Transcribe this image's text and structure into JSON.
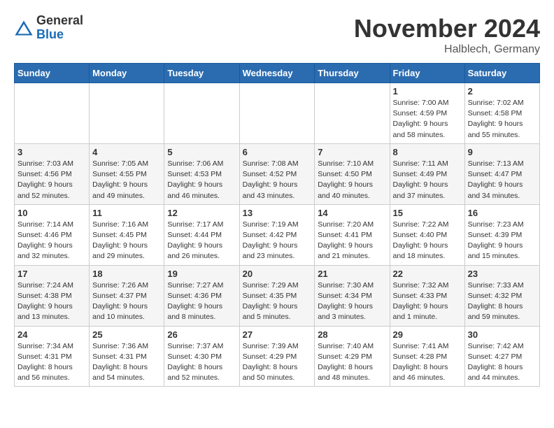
{
  "logo": {
    "general": "General",
    "blue": "Blue"
  },
  "title": "November 2024",
  "subtitle": "Halblech, Germany",
  "days_of_week": [
    "Sunday",
    "Monday",
    "Tuesday",
    "Wednesday",
    "Thursday",
    "Friday",
    "Saturday"
  ],
  "weeks": [
    [
      {
        "day": "",
        "info": ""
      },
      {
        "day": "",
        "info": ""
      },
      {
        "day": "",
        "info": ""
      },
      {
        "day": "",
        "info": ""
      },
      {
        "day": "",
        "info": ""
      },
      {
        "day": "1",
        "info": "Sunrise: 7:00 AM\nSunset: 4:59 PM\nDaylight: 9 hours and 58 minutes."
      },
      {
        "day": "2",
        "info": "Sunrise: 7:02 AM\nSunset: 4:58 PM\nDaylight: 9 hours and 55 minutes."
      }
    ],
    [
      {
        "day": "3",
        "info": "Sunrise: 7:03 AM\nSunset: 4:56 PM\nDaylight: 9 hours and 52 minutes."
      },
      {
        "day": "4",
        "info": "Sunrise: 7:05 AM\nSunset: 4:55 PM\nDaylight: 9 hours and 49 minutes."
      },
      {
        "day": "5",
        "info": "Sunrise: 7:06 AM\nSunset: 4:53 PM\nDaylight: 9 hours and 46 minutes."
      },
      {
        "day": "6",
        "info": "Sunrise: 7:08 AM\nSunset: 4:52 PM\nDaylight: 9 hours and 43 minutes."
      },
      {
        "day": "7",
        "info": "Sunrise: 7:10 AM\nSunset: 4:50 PM\nDaylight: 9 hours and 40 minutes."
      },
      {
        "day": "8",
        "info": "Sunrise: 7:11 AM\nSunset: 4:49 PM\nDaylight: 9 hours and 37 minutes."
      },
      {
        "day": "9",
        "info": "Sunrise: 7:13 AM\nSunset: 4:47 PM\nDaylight: 9 hours and 34 minutes."
      }
    ],
    [
      {
        "day": "10",
        "info": "Sunrise: 7:14 AM\nSunset: 4:46 PM\nDaylight: 9 hours and 32 minutes."
      },
      {
        "day": "11",
        "info": "Sunrise: 7:16 AM\nSunset: 4:45 PM\nDaylight: 9 hours and 29 minutes."
      },
      {
        "day": "12",
        "info": "Sunrise: 7:17 AM\nSunset: 4:44 PM\nDaylight: 9 hours and 26 minutes."
      },
      {
        "day": "13",
        "info": "Sunrise: 7:19 AM\nSunset: 4:42 PM\nDaylight: 9 hours and 23 minutes."
      },
      {
        "day": "14",
        "info": "Sunrise: 7:20 AM\nSunset: 4:41 PM\nDaylight: 9 hours and 21 minutes."
      },
      {
        "day": "15",
        "info": "Sunrise: 7:22 AM\nSunset: 4:40 PM\nDaylight: 9 hours and 18 minutes."
      },
      {
        "day": "16",
        "info": "Sunrise: 7:23 AM\nSunset: 4:39 PM\nDaylight: 9 hours and 15 minutes."
      }
    ],
    [
      {
        "day": "17",
        "info": "Sunrise: 7:24 AM\nSunset: 4:38 PM\nDaylight: 9 hours and 13 minutes."
      },
      {
        "day": "18",
        "info": "Sunrise: 7:26 AM\nSunset: 4:37 PM\nDaylight: 9 hours and 10 minutes."
      },
      {
        "day": "19",
        "info": "Sunrise: 7:27 AM\nSunset: 4:36 PM\nDaylight: 9 hours and 8 minutes."
      },
      {
        "day": "20",
        "info": "Sunrise: 7:29 AM\nSunset: 4:35 PM\nDaylight: 9 hours and 5 minutes."
      },
      {
        "day": "21",
        "info": "Sunrise: 7:30 AM\nSunset: 4:34 PM\nDaylight: 9 hours and 3 minutes."
      },
      {
        "day": "22",
        "info": "Sunrise: 7:32 AM\nSunset: 4:33 PM\nDaylight: 9 hours and 1 minute."
      },
      {
        "day": "23",
        "info": "Sunrise: 7:33 AM\nSunset: 4:32 PM\nDaylight: 8 hours and 59 minutes."
      }
    ],
    [
      {
        "day": "24",
        "info": "Sunrise: 7:34 AM\nSunset: 4:31 PM\nDaylight: 8 hours and 56 minutes."
      },
      {
        "day": "25",
        "info": "Sunrise: 7:36 AM\nSunset: 4:31 PM\nDaylight: 8 hours and 54 minutes."
      },
      {
        "day": "26",
        "info": "Sunrise: 7:37 AM\nSunset: 4:30 PM\nDaylight: 8 hours and 52 minutes."
      },
      {
        "day": "27",
        "info": "Sunrise: 7:39 AM\nSunset: 4:29 PM\nDaylight: 8 hours and 50 minutes."
      },
      {
        "day": "28",
        "info": "Sunrise: 7:40 AM\nSunset: 4:29 PM\nDaylight: 8 hours and 48 minutes."
      },
      {
        "day": "29",
        "info": "Sunrise: 7:41 AM\nSunset: 4:28 PM\nDaylight: 8 hours and 46 minutes."
      },
      {
        "day": "30",
        "info": "Sunrise: 7:42 AM\nSunset: 4:27 PM\nDaylight: 8 hours and 44 minutes."
      }
    ]
  ]
}
